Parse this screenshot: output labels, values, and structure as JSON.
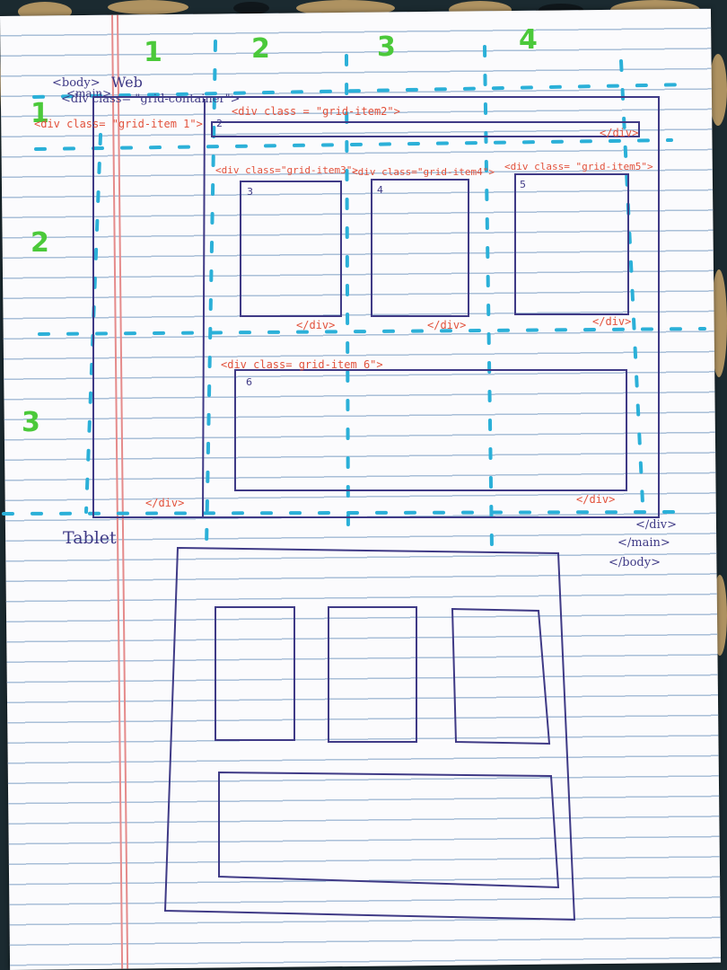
{
  "column_numbers": [
    "1",
    "2",
    "3",
    "4"
  ],
  "row_numbers": [
    "1",
    "2",
    "3"
  ],
  "web_label": "Web",
  "opening_tags": {
    "body": "<body>",
    "main": "<main>",
    "container": "<div class= \"grid-container\">"
  },
  "item_tags": {
    "item1": "<div class= \"grid-item 1\">",
    "item2": "<div class = \"grid-item2\">",
    "item3": "<div class=\"grid-item3\">",
    "item4": "<div class=\"grid-item4\">",
    "item5": "<div class= \"grid-item5\">",
    "item6": "<div class= grid-item 6\">"
  },
  "item_numbers": [
    "2",
    "3",
    "4",
    "5",
    "6"
  ],
  "close_div": "</div>",
  "closing_tags": {
    "div": "</div>",
    "main": "</main>",
    "body": "</body>"
  },
  "tablet_label": "Tablet",
  "colors": {
    "pen": "#3f3a86",
    "guide": "#2bb0d8",
    "numbers": "#4bc93a",
    "tags": "#e2523c"
  }
}
